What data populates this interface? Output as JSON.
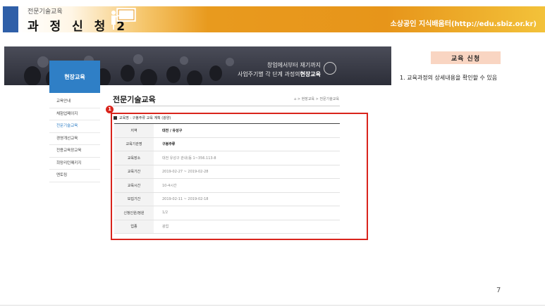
{
  "header": {
    "subtitle": "전문기술교육",
    "title": "과 정 신 청 2",
    "right_text": "소상공인 지식배움터(http://edu.sbiz.or.kr)",
    "presenter_icon": "presenter-board-icon"
  },
  "banner": {
    "line1": "창업에서부터 재기까지",
    "line2_prefix": "사업주기별 각 단계 과정의",
    "line2_bold": "현장교육"
  },
  "sidebar": {
    "title": "현장교육",
    "items": [
      {
        "label": "교육안내"
      },
      {
        "label": "체험업페이지"
      },
      {
        "label": "전문기술교육"
      },
      {
        "label": "경영개선교육"
      },
      {
        "label": "전용교육장교육"
      },
      {
        "label": "희망리턴패키지"
      },
      {
        "label": "멘토링"
      }
    ],
    "active_index": 2
  },
  "content": {
    "title": "전문기술교육",
    "breadcrumb": "⌂ > 현장교육 > 전문기술교육",
    "badge_number": "1",
    "course_label": "교육명 : 구봉주류 교육 계획 (광양)",
    "table": [
      {
        "key": "지역",
        "value": "대전 / 유성구",
        "strong": true
      },
      {
        "key": "교육기관명",
        "value": "구봉주류",
        "strong": true
      },
      {
        "key": "교육장소",
        "value": "대전 유성구 관내(동 1~356.113-8",
        "strong": false
      },
      {
        "key": "교육기간",
        "value": "2019-02-27 ~ 2019-02-28",
        "strong": false
      },
      {
        "key": "교육시간",
        "value": "10-4시간",
        "strong": false
      },
      {
        "key": "모집기간",
        "value": "2019-02-11 ~ 2019-02-18",
        "strong": false
      },
      {
        "key": "신청인원/정원",
        "value": "1/2",
        "strong": false
      },
      {
        "key": "업종",
        "value": "광업",
        "strong": false
      }
    ]
  },
  "right_panel": {
    "label": "교육 신청",
    "text": "1.  교육과정의 상세내용을 확인할 수 있음"
  },
  "page_number": "7",
  "colors": {
    "accent_blue": "#2f7fc6",
    "header_orange": "#e7951a",
    "highlight_red": "#d9241c",
    "label_peach": "#f9d5c2"
  }
}
